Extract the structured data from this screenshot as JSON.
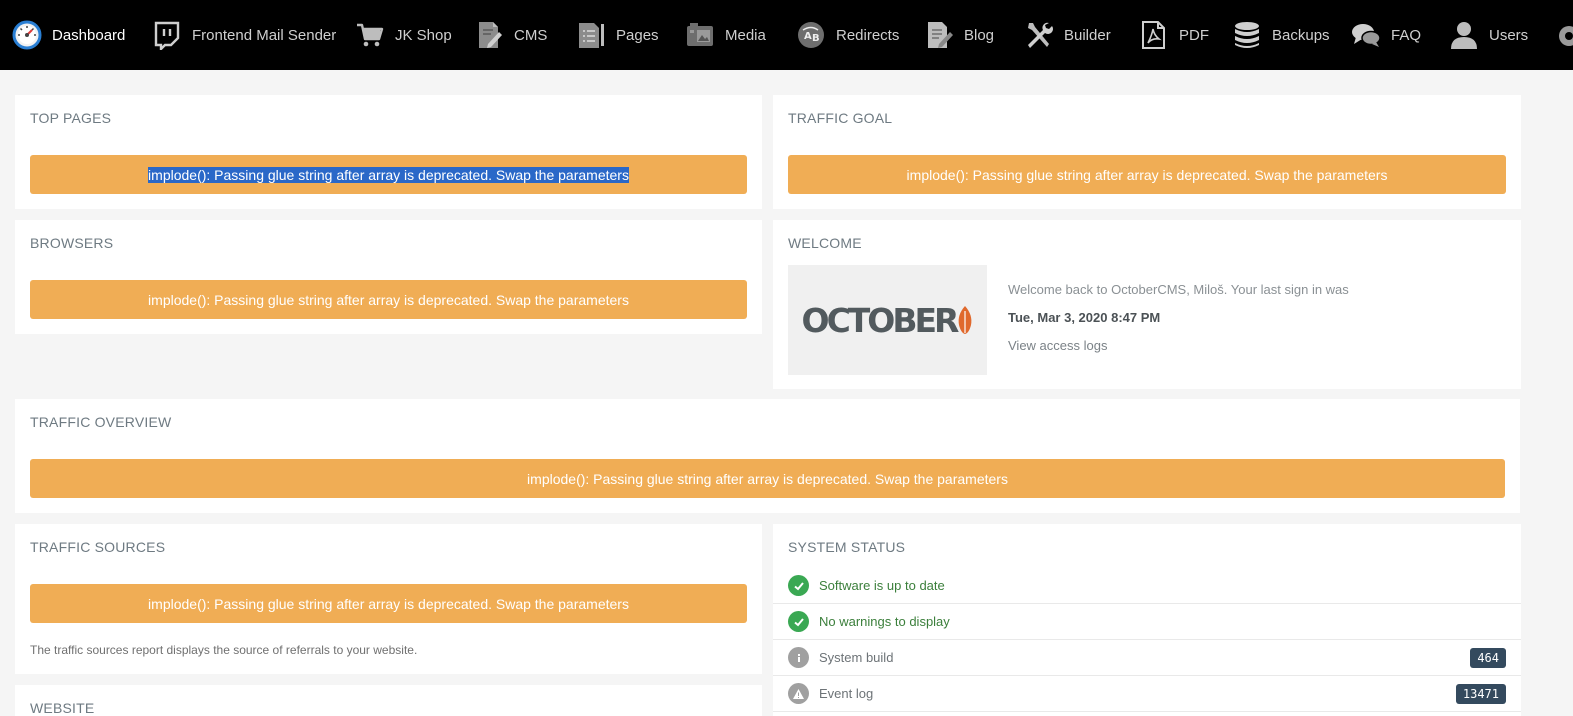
{
  "nav": {
    "items": [
      {
        "label": "Dashboard",
        "icon": "speedometer-icon"
      },
      {
        "label": "Frontend Mail Sender",
        "icon": "twitch-icon"
      },
      {
        "label": "JK Shop",
        "icon": "cart-icon"
      },
      {
        "label": "CMS",
        "icon": "document-pencil-icon"
      },
      {
        "label": "Pages",
        "icon": "pages-icon"
      },
      {
        "label": "Media",
        "icon": "media-icon"
      },
      {
        "label": "Redirects",
        "icon": "redirects-icon"
      },
      {
        "label": "Blog",
        "icon": "blog-icon"
      },
      {
        "label": "Builder",
        "icon": "tools-icon"
      },
      {
        "label": "PDF",
        "icon": "pdf-icon"
      },
      {
        "label": "Backups",
        "icon": "database-icon"
      },
      {
        "label": "FAQ",
        "icon": "chat-icon"
      },
      {
        "label": "Users",
        "icon": "user-icon"
      }
    ]
  },
  "error_message": "implode(): Passing glue string after array is deprecated. Swap the parameters",
  "widgets": {
    "top_pages": {
      "title": "Top Pages"
    },
    "traffic_goal": {
      "title": "Traffic Goal"
    },
    "browsers": {
      "title": "Browsers"
    },
    "welcome": {
      "title": "Welcome",
      "logo_text": "OCTOBER",
      "message": "Welcome back to OctoberCMS, Miloš. Your last sign in was",
      "last_sign_in": "Tue, Mar 3, 2020 8:47 PM",
      "access_logs_link": "View access logs"
    },
    "traffic_overview": {
      "title": "Traffic Overview"
    },
    "traffic_sources": {
      "title": "Traffic Sources",
      "note": "The traffic sources report displays the source of referrals to your website."
    },
    "system_status": {
      "title": "System Status",
      "rows": [
        {
          "label": "Software is up to date",
          "state": "ok"
        },
        {
          "label": "No warnings to display",
          "state": "ok"
        },
        {
          "label": "System build",
          "state": "info",
          "badge": "464"
        },
        {
          "label": "Event log",
          "state": "warning",
          "badge": "13471"
        }
      ]
    },
    "website": {
      "title": "Website"
    }
  },
  "colors": {
    "nav_bg": "#000000",
    "alert_bg": "#f0ad55",
    "success": "#3aa853",
    "badge_bg": "#344a5e",
    "logo_accent": "#e0692d"
  }
}
